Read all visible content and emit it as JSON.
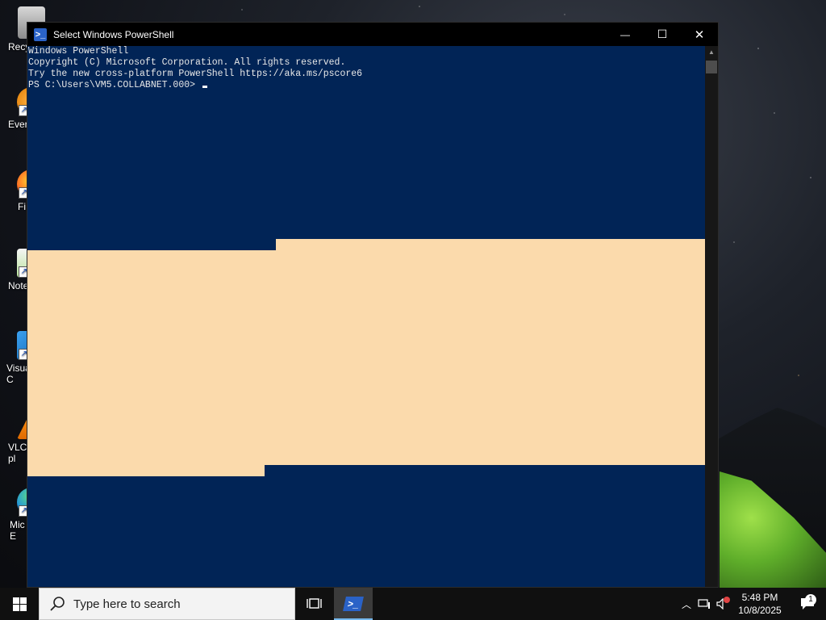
{
  "desktop": {
    "icons": [
      {
        "label": "Recy",
        "name": "recycle-bin"
      },
      {
        "label": "Ever",
        "name": "everything"
      },
      {
        "label": "Fi",
        "name": "firefox"
      },
      {
        "label": "Note",
        "name": "notepad-plus-plus"
      },
      {
        "label": "Visua\nC",
        "name": "visual-studio-code"
      },
      {
        "label": "VLC\npl",
        "name": "vlc-player"
      },
      {
        "label": "Mic\nE",
        "name": "microsoft-edge"
      }
    ]
  },
  "window": {
    "title": "Select Windows PowerShell",
    "minimize_glyph": "—",
    "maximize_glyph": "☐",
    "close_glyph": "✕",
    "console_lines": [
      "Windows PowerShell",
      "Copyright (C) Microsoft Corporation. All rights reserved.",
      "",
      "Try the new cross-platform PowerShell https://aka.ms/pscore6",
      "",
      "PS C:\\Users\\VM5.COLLABNET.000> "
    ],
    "selection_color": "#fbdaac",
    "background_color": "#012456"
  },
  "taskbar": {
    "search_placeholder": "Type here to search",
    "clock_time": "5:48 PM",
    "clock_date": "10/8/2025",
    "notification_count": "1"
  }
}
